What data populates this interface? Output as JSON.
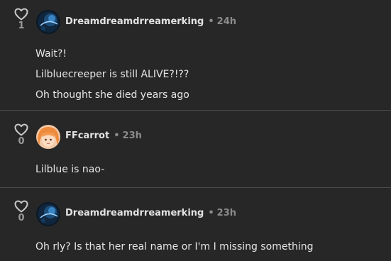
{
  "comments": [
    {
      "username": "Dreamdreamdrreamerking",
      "time": "24h",
      "votes": "1",
      "lines": [
        "Wait?!",
        "Lilbluecreeper is still ALIVE?!??",
        "Oh thought she died years ago"
      ],
      "avatar_icon": "dark-planet-avatar"
    },
    {
      "username": "FFcarrot",
      "time": "23h",
      "votes": "0",
      "lines": [
        "Lilblue is nao-"
      ],
      "avatar_icon": "orange-hair-anime-avatar"
    },
    {
      "username": "Dreamdreamdrreamerking",
      "time": "23h",
      "votes": "0",
      "lines": [
        "Oh rly? Is that her real name or I'm I missing something"
      ],
      "avatar_icon": "dark-planet-avatar"
    }
  ],
  "separator": "•",
  "colors": {
    "background": "#272727",
    "text": "#e6e6e6",
    "muted": "#8b8b8b",
    "divider": "#4a4a4a"
  }
}
